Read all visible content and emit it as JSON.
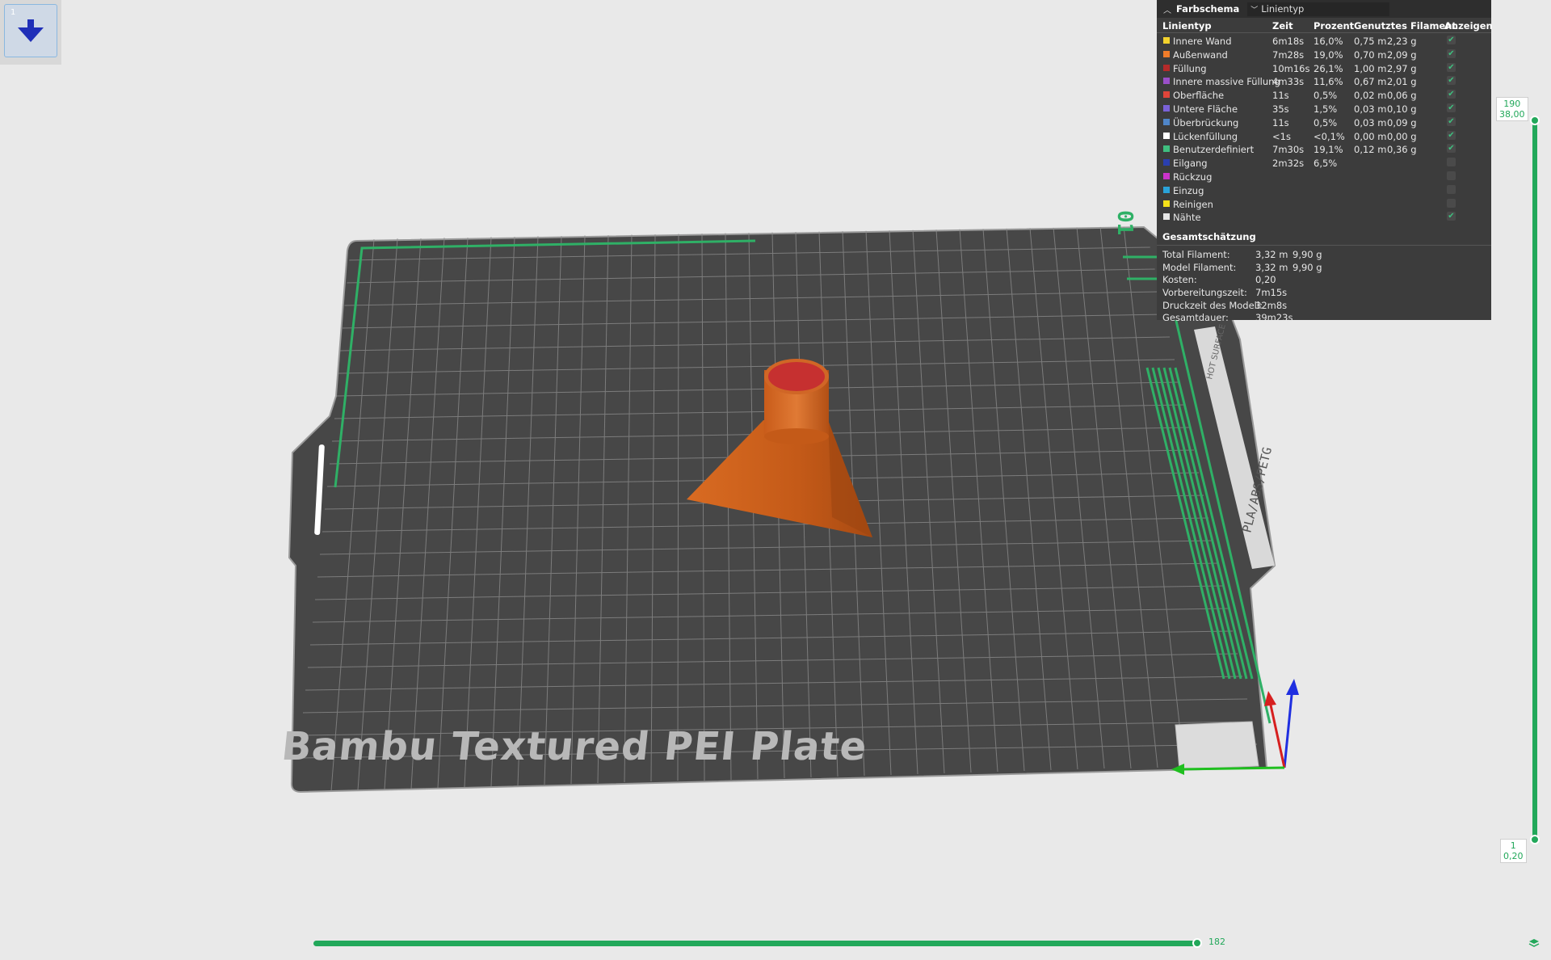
{
  "colors": {
    "accent": "#22a85a",
    "model": "#c9601c",
    "plate": "#474747",
    "panel": "#3c3c3c"
  },
  "thumbnail": {
    "index": "1"
  },
  "legend": {
    "header_title": "Farbschema",
    "view_type": "Linientyp",
    "columns": [
      "Linientyp",
      "Zeit",
      "Prozent",
      "Genutztes Filament",
      "Anzeigen"
    ],
    "rows": [
      {
        "name": "Innere Wand",
        "color": "#f2d22d",
        "time": "6m18s",
        "percent": "16,0%",
        "length": "0,75 m",
        "weight": "2,23 g",
        "shown": true
      },
      {
        "name": "Außenwand",
        "color": "#f07c2a",
        "time": "7m28s",
        "percent": "19,0%",
        "length": "0,70 m",
        "weight": "2,09 g",
        "shown": true
      },
      {
        "name": "Füllung",
        "color": "#b52a2a",
        "time": "10m16s",
        "percent": "26,1%",
        "length": "1,00 m",
        "weight": "2,97 g",
        "shown": true
      },
      {
        "name": "Innere massive Füllung",
        "color": "#9a4fc9",
        "time": "4m33s",
        "percent": "11,6%",
        "length": "0,67 m",
        "weight": "2,01 g",
        "shown": true
      },
      {
        "name": "Oberfläche",
        "color": "#e0453a",
        "time": "11s",
        "percent": "0,5%",
        "length": "0,02 m",
        "weight": "0,06 g",
        "shown": true
      },
      {
        "name": "Untere Fläche",
        "color": "#7a62d8",
        "time": "35s",
        "percent": "1,5%",
        "length": "0,03 m",
        "weight": "0,10 g",
        "shown": true
      },
      {
        "name": "Überbrückung",
        "color": "#4f86c9",
        "time": "11s",
        "percent": "0,5%",
        "length": "0,03 m",
        "weight": "0,09 g",
        "shown": true
      },
      {
        "name": "Lückenfüllung",
        "color": "#ffffff",
        "time": "<1s",
        "percent": "<0,1%",
        "length": "0,00 m",
        "weight": "0,00 g",
        "shown": true
      },
      {
        "name": "Benutzerdefiniert",
        "color": "#3fbf7f",
        "time": "7m30s",
        "percent": "19,1%",
        "length": "0,12 m",
        "weight": "0,36 g",
        "shown": true
      },
      {
        "name": "Eilgang",
        "color": "#2a3fb0",
        "time": "2m32s",
        "percent": "6,5%",
        "length": "",
        "weight": "",
        "shown": false
      },
      {
        "name": "Rückzug",
        "color": "#cc33cc",
        "time": "",
        "percent": "",
        "length": "",
        "weight": "",
        "shown": false
      },
      {
        "name": "Einzug",
        "color": "#2aa3d9",
        "time": "",
        "percent": "",
        "length": "",
        "weight": "",
        "shown": false
      },
      {
        "name": "Reinigen",
        "color": "#f5e11a",
        "time": "",
        "percent": "",
        "length": "",
        "weight": "",
        "shown": false
      },
      {
        "name": "Nähte",
        "color": "#e6e6e6",
        "time": "",
        "percent": "",
        "length": "",
        "weight": "",
        "shown": true
      }
    ],
    "estimate": {
      "title": "Gesamtschätzung",
      "rows": [
        {
          "label": "Total Filament:",
          "value": "3,32 m",
          "value2": "9,90 g"
        },
        {
          "label": "Model Filament:",
          "value": "3,32 m",
          "value2": "9,90 g"
        },
        {
          "label": "Kosten:",
          "value": "0,20",
          "value2": ""
        },
        {
          "label": "Vorbereitungszeit:",
          "value": "7m15s",
          "value2": ""
        },
        {
          "label": "Druckzeit des Modell:",
          "value": "32m8s",
          "value2": ""
        },
        {
          "label": "Gesamtdauer:",
          "value": "39m23s",
          "value2": ""
        }
      ]
    }
  },
  "plate": {
    "name": "Bambu Textured PEI Plate",
    "plate_number": "01",
    "side_label": "PLA/ABS/PETG",
    "hot_label": "HOT SURFACE"
  },
  "layer_slider": {
    "top_layer": "190",
    "top_height": "38,00",
    "bottom_layer": "1",
    "bottom_height": "0,20"
  },
  "move_slider": {
    "value": "182"
  }
}
